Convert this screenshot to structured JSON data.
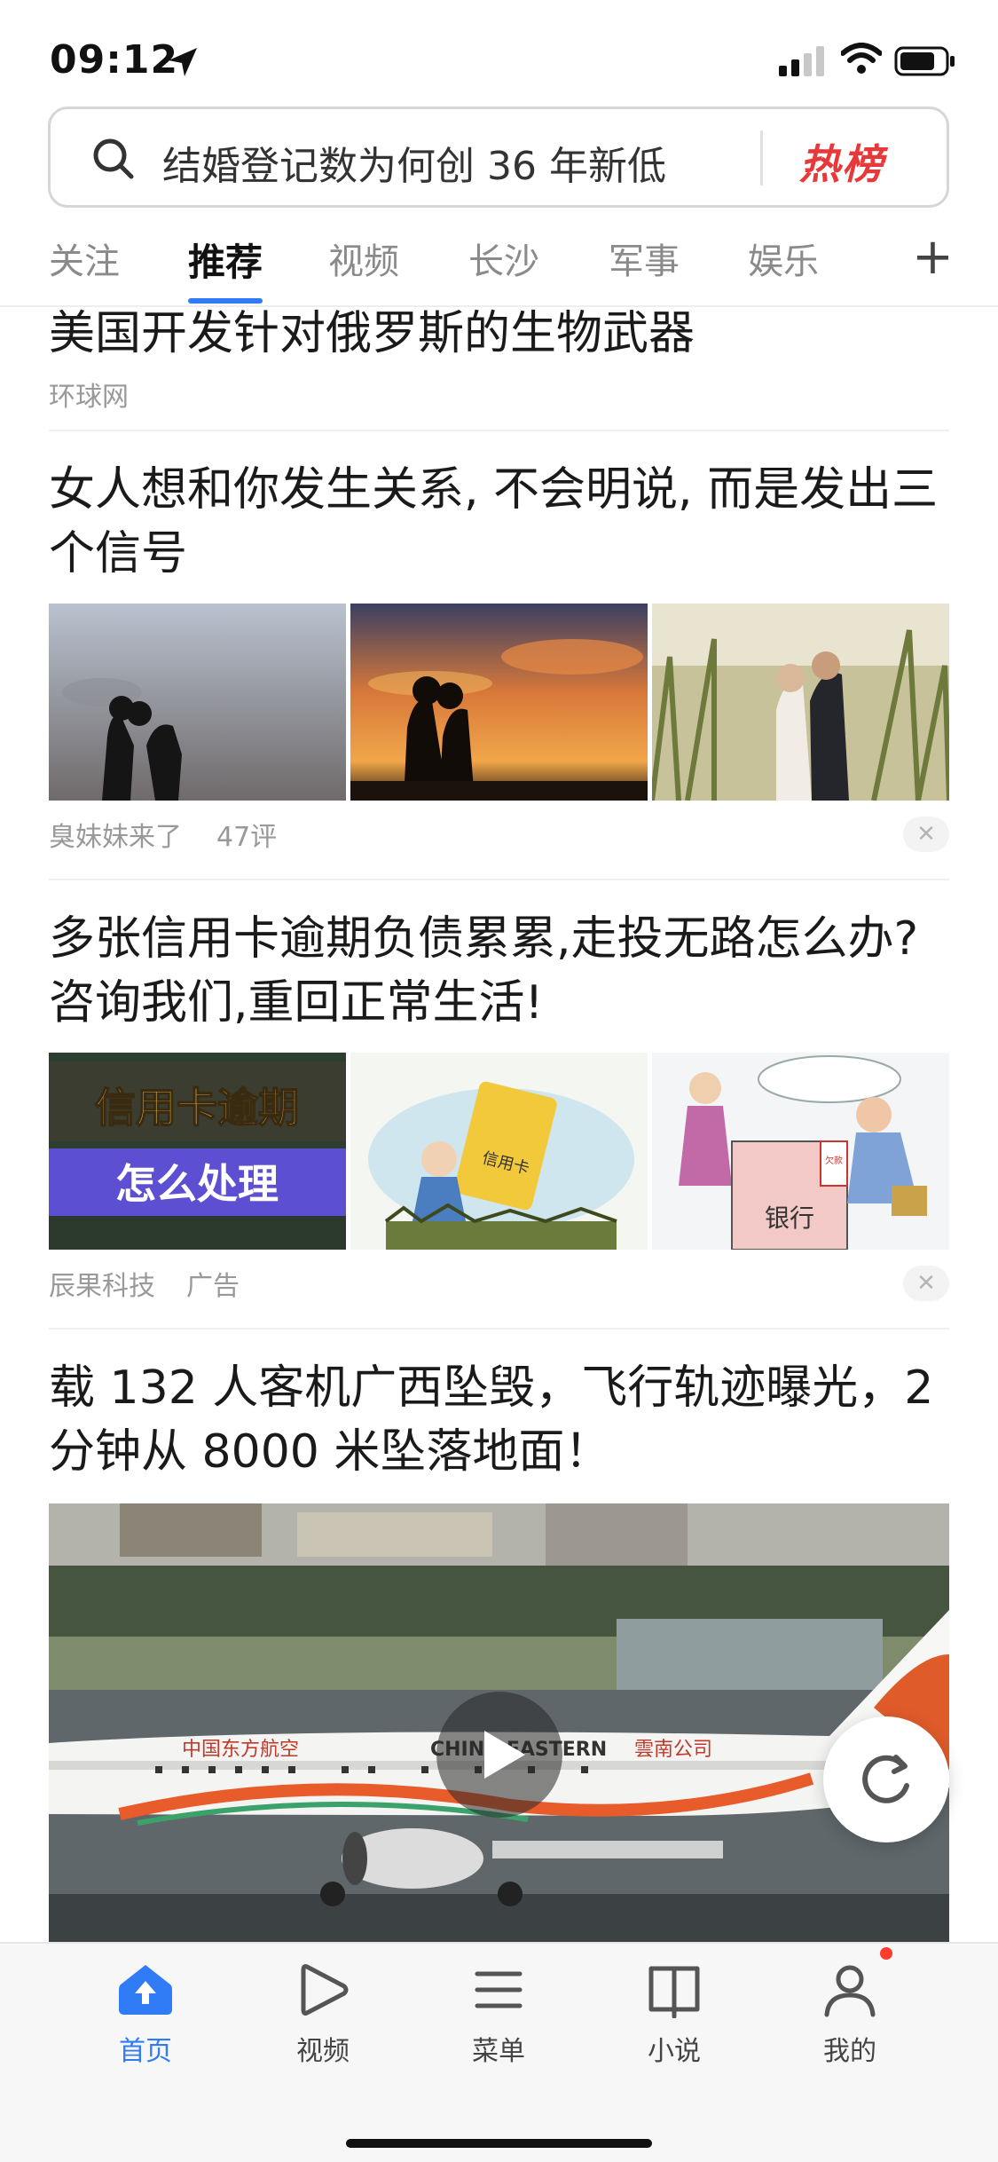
{
  "status_bar": {
    "time": "09:12"
  },
  "search": {
    "query": "结婚登记数为何创 36 年新低",
    "hot_label": "热榜"
  },
  "tabs": [
    {
      "label": "关注"
    },
    {
      "label": "推荐"
    },
    {
      "label": "视频"
    },
    {
      "label": "长沙"
    },
    {
      "label": "军事"
    },
    {
      "label": "娱乐"
    }
  ],
  "feed": [
    {
      "title": "美国开发针对俄罗斯的生物武器",
      "source": "环球网"
    },
    {
      "title": "女人想和你发生关系, 不会明说, 而是发出三个信号",
      "source": "臭妹妹来了",
      "comments": "47评"
    },
    {
      "title": "多张信用卡逾期负债累累,走投无路怎么办?咨询我们,重回正常生活!",
      "source": "辰果科技",
      "ad_label": "广告",
      "image_texts": {
        "card_line1": "信用卡逾期",
        "card_line2": "怎么处理",
        "card_label": "信用卡",
        "bank_label": "银行",
        "debt_label": "欠款"
      }
    },
    {
      "title": "载 132 人客机广西坠毁，飞行轨迹曝光，2分钟从 8000 米坠落地面！",
      "plane_texts": {
        "cn": "中国东方航空",
        "en": "CHINA EASTERN",
        "sub": "雲南公司"
      }
    }
  ],
  "bottom_nav": [
    {
      "label": "首页",
      "icon": "home-arrow-icon",
      "active": true
    },
    {
      "label": "视频",
      "icon": "play-icon"
    },
    {
      "label": "菜单",
      "icon": "menu-icon"
    },
    {
      "label": "小说",
      "icon": "book-icon"
    },
    {
      "label": "我的",
      "icon": "profile-icon",
      "badge": true
    }
  ],
  "colors": {
    "accent": "#2f7cf6",
    "hot": "#e8393a",
    "badge": "#ff3b30"
  }
}
